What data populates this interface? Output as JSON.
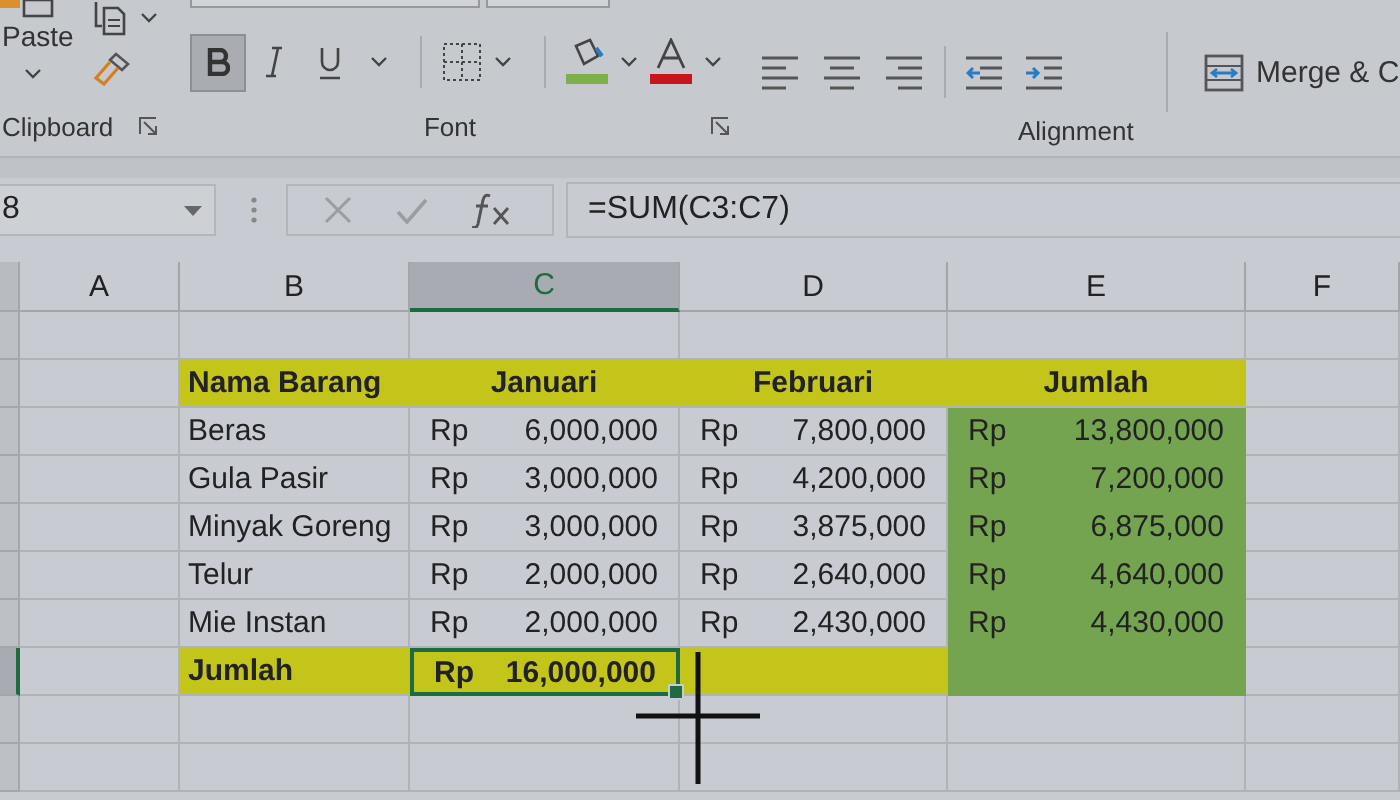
{
  "ribbon": {
    "clipboard": {
      "label": "Clipboard",
      "paste_label": "Paste"
    },
    "font": {
      "label": "Font",
      "bold": {
        "selected": true
      },
      "italic": {
        "selected": false
      },
      "underline": {
        "selected": false
      }
    },
    "alignment": {
      "label": "Alignment",
      "merge_label": "Merge & C"
    }
  },
  "formula_bar": {
    "name_box": "8",
    "cancel": {
      "disabled": true
    },
    "enter": {
      "disabled": true
    },
    "formula": "=SUM(C3:C7)"
  },
  "column_headers": [
    {
      "label": "A",
      "selected": false
    },
    {
      "label": "B",
      "selected": false
    },
    {
      "label": "C",
      "selected": true
    },
    {
      "label": "D",
      "selected": false
    },
    {
      "label": "E",
      "selected": false
    },
    {
      "label": "F",
      "selected": false
    }
  ],
  "table": {
    "header": {
      "item": "Nama Barang",
      "january": "Januari",
      "february": "Februari",
      "total": "Jumlah"
    },
    "items": [
      {
        "name": "Beras",
        "january": {
          "currency": "Rp",
          "amount": "6,000,000"
        },
        "february": {
          "currency": "Rp",
          "amount": "7,800,000"
        },
        "total": {
          "currency": "Rp",
          "amount": "13,800,000"
        }
      },
      {
        "name": "Gula Pasir",
        "january": {
          "currency": "Rp",
          "amount": "3,000,000"
        },
        "february": {
          "currency": "Rp",
          "amount": "4,200,000"
        },
        "total": {
          "currency": "Rp",
          "amount": "7,200,000"
        }
      },
      {
        "name": "Minyak Goreng",
        "january": {
          "currency": "Rp",
          "amount": "3,000,000"
        },
        "february": {
          "currency": "Rp",
          "amount": "3,875,000"
        },
        "total": {
          "currency": "Rp",
          "amount": "6,875,000"
        }
      },
      {
        "name": "Telur",
        "january": {
          "currency": "Rp",
          "amount": "2,000,000"
        },
        "february": {
          "currency": "Rp",
          "amount": "2,640,000"
        },
        "total": {
          "currency": "Rp",
          "amount": "4,640,000"
        }
      },
      {
        "name": "Mie Instan",
        "january": {
          "currency": "Rp",
          "amount": "2,000,000"
        },
        "february": {
          "currency": "Rp",
          "amount": "2,430,000"
        },
        "total": {
          "currency": "Rp",
          "amount": "4,430,000"
        }
      }
    ],
    "total_row": {
      "label": "Jumlah",
      "january": {
        "currency": "Rp",
        "amount": "16,000,000",
        "selected": true
      }
    }
  }
}
